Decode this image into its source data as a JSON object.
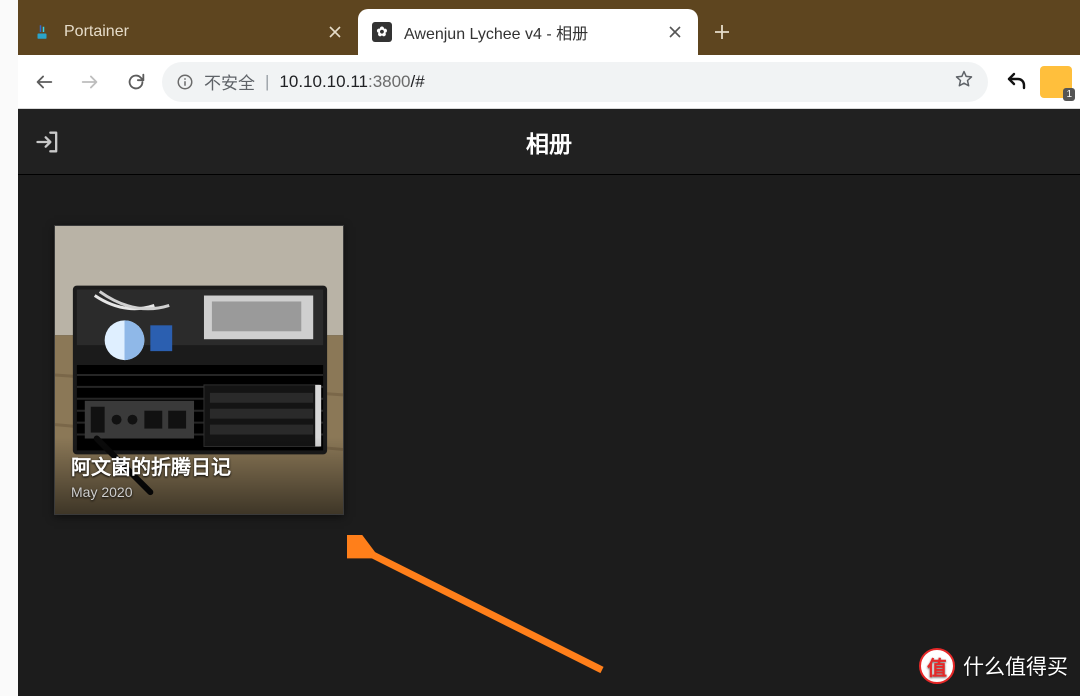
{
  "browser": {
    "tabs": [
      {
        "label": "Portainer",
        "active": false
      },
      {
        "label": "Awenjun Lychee v4 - 相册",
        "active": true
      }
    ],
    "nav": {
      "insecure_label": "不安全",
      "url_host": "10.10.10.11",
      "url_port": ":3800",
      "url_path": "/#"
    },
    "extension_badge_count": "1"
  },
  "app": {
    "header_title": "相册"
  },
  "albums": [
    {
      "title": "阿文菌的折腾日记",
      "date": "May 2020"
    }
  ],
  "watermark": {
    "badge_char": "值",
    "text": "什么值得买"
  }
}
